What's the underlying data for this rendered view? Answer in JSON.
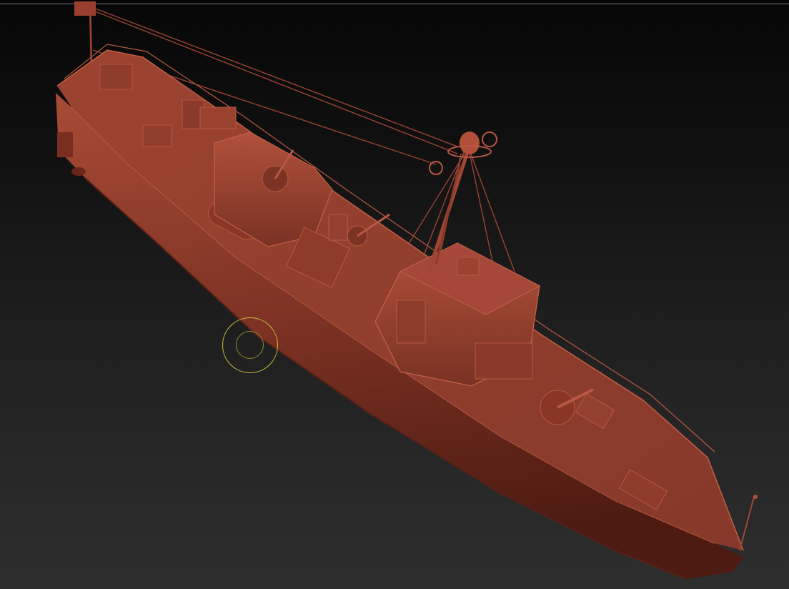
{
  "app": {
    "name": "",
    "mode": "3d-sculpt-viewport"
  },
  "viewport": {
    "background_top": "#070707",
    "background_bottom": "#2e2e2e",
    "separator_color": "#7a7a7a"
  },
  "model": {
    "subject": "patrol-boat-sculpt",
    "material_color": "#8a3a29",
    "highlight_color": "#b4553f",
    "shadow_color": "#4a1a12"
  },
  "cursor": {
    "type": "draw-brush-cursor",
    "color": "#c8c23a"
  }
}
